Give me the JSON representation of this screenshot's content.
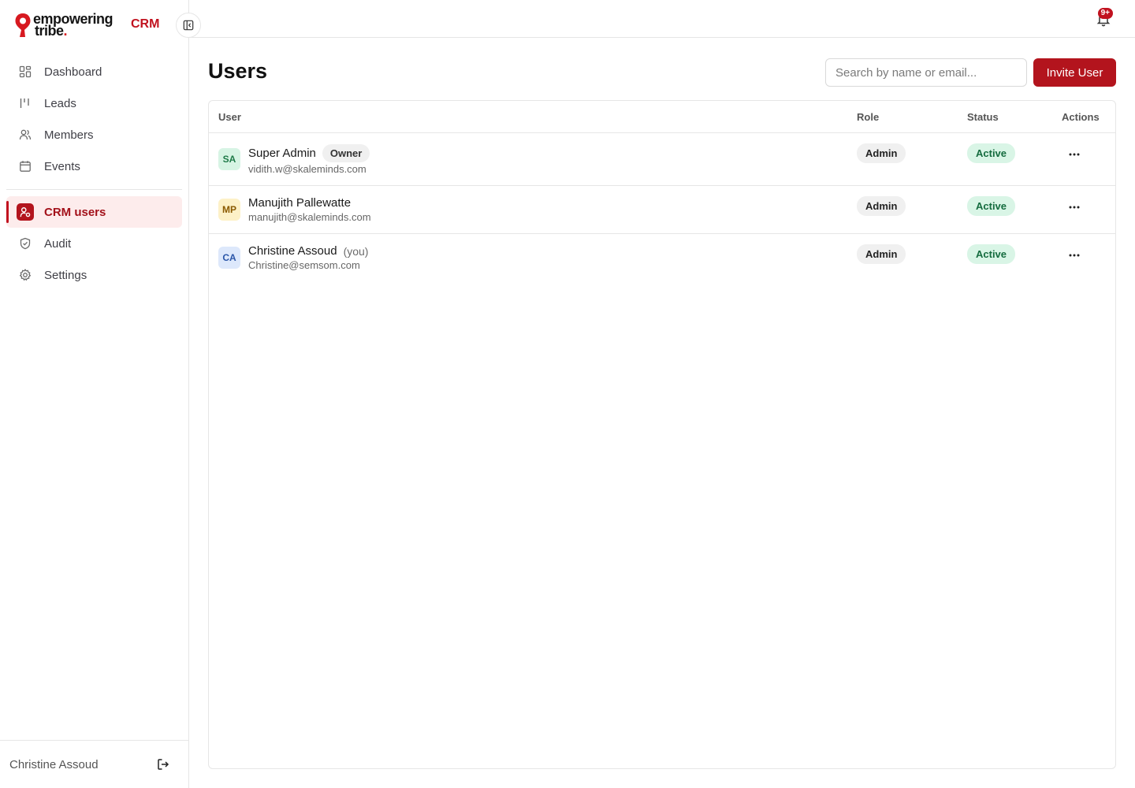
{
  "brand": {
    "line1": "empowering",
    "line2": "tribe",
    "dot": ".",
    "product": "CRM",
    "accent": "#c1121f"
  },
  "sidebar": {
    "items": [
      {
        "label": "Dashboard",
        "icon": "dashboard-icon"
      },
      {
        "label": "Leads",
        "icon": "leads-icon"
      },
      {
        "label": "Members",
        "icon": "members-icon"
      },
      {
        "label": "Events",
        "icon": "calendar-icon"
      },
      {
        "label": "CRM users",
        "icon": "crm-users-icon",
        "active": true
      },
      {
        "label": "Audit",
        "icon": "shield-icon"
      },
      {
        "label": "Settings",
        "icon": "gear-icon"
      }
    ],
    "footer_user": "Christine Assoud"
  },
  "topbar": {
    "notification_badge": "9+"
  },
  "page": {
    "title": "Users",
    "search_placeholder": "Search by name or email...",
    "invite_label": "Invite User"
  },
  "table": {
    "columns": [
      "User",
      "Role",
      "Status",
      "Actions"
    ],
    "rows": [
      {
        "initials": "SA",
        "name": "Super Admin",
        "tag": "Owner",
        "email": "vidith.w@skaleminds.com",
        "role": "Admin",
        "status": "Active",
        "avatar_bg": "#d7f4e4",
        "avatar_fg": "#1f7a48"
      },
      {
        "initials": "MP",
        "name": "Manujith Pallewatte",
        "tag": "",
        "email": "manujith@skaleminds.com",
        "role": "Admin",
        "status": "Active",
        "avatar_bg": "#fdf1c7",
        "avatar_fg": "#8a5a00"
      },
      {
        "initials": "CA",
        "name": "Christine Assoud",
        "tag": "(you)",
        "email": "Christine@semsom.com",
        "role": "Admin",
        "status": "Active",
        "avatar_bg": "#dde8fb",
        "avatar_fg": "#2b56a8"
      }
    ],
    "actions_glyph": "..."
  }
}
